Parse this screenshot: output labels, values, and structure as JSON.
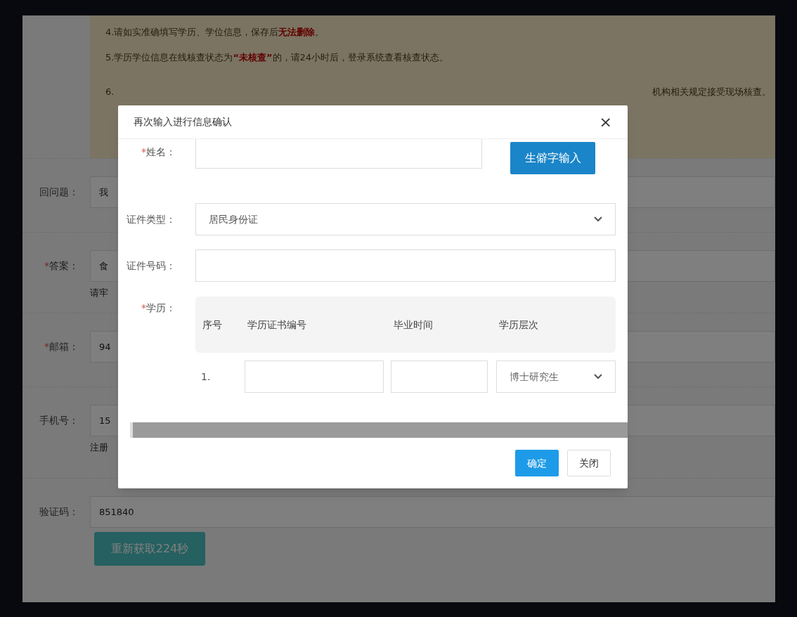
{
  "notice": {
    "lines": [
      "4.请如实准确填写学历、学位信息，保存后**无法删除**。",
      "5.学历学位信息在线核查状态为**“未核查”**的，请24小时后，登录系统查看核查状态。"
    ],
    "line_6": {
      "start": "6.",
      "end": "机构相关规定接受现场核查。"
    }
  },
  "form": [
    {
      "label": "回问题：",
      "value": "我"
    },
    {
      "label": "答案：",
      "marker": "*",
      "value": "食",
      "hint": "请牢"
    },
    {
      "label": "邮箱：",
      "marker": "*",
      "value": "94"
    },
    {
      "label": "手机号：",
      "value": "15",
      "hint": "注册"
    },
    {
      "label": "验证码：",
      "value": "851840"
    }
  ],
  "resend_button": "重新获取224秒",
  "dialog": {
    "title": "再次输入进行信息确认",
    "close": "×",
    "name": {
      "marker": "*",
      "label": "姓名：",
      "button": "生僻字输入"
    },
    "id_type": {
      "label": "证件类型：",
      "value": "居民身份证"
    },
    "id_number": {
      "label": "证件号码："
    },
    "education": {
      "marker": "*",
      "label": "学历：",
      "columns": [
        "序号",
        "学历证书编号",
        "毕业时间",
        "学历层次"
      ],
      "rows": [
        {
          "index": "1.",
          "level": "博士研究生"
        }
      ]
    },
    "buttons": [
      {
        "label": "确定",
        "kind": "primary"
      },
      {
        "label": "关闭",
        "kind": "default"
      }
    ]
  }
}
